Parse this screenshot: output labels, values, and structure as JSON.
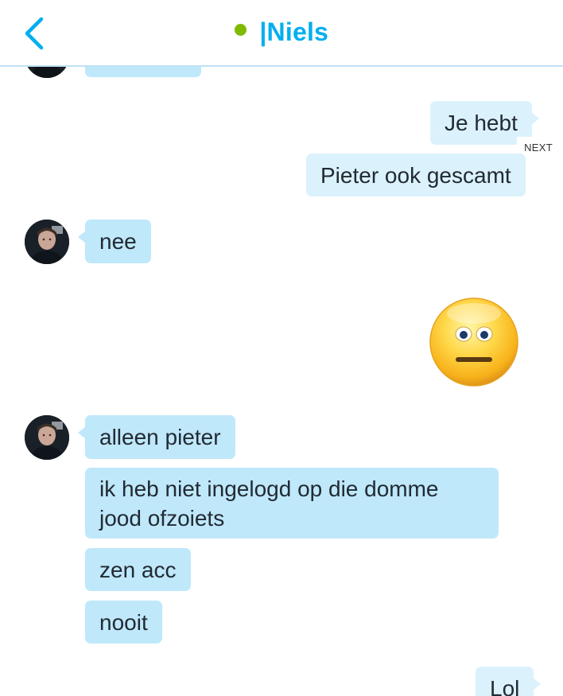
{
  "header": {
    "back_icon": "chevron-left-icon",
    "presence_color": "#7fba00",
    "contact_name": "|Niels"
  },
  "hint": {
    "next_label": "NEXT"
  },
  "messages": [
    {
      "from": "contact",
      "text": ""
    },
    {
      "from": "me",
      "text": "Je hebt"
    },
    {
      "from": "me",
      "text": "Pieter ook gescamt"
    },
    {
      "from": "contact",
      "text": "nee"
    },
    {
      "from": "me",
      "emoticon": "speechless-emoticon"
    },
    {
      "from": "contact",
      "text": "alleen pieter"
    },
    {
      "from": "contact",
      "text": "ik heb niet ingelogd op die domme jood ofzoiets"
    },
    {
      "from": "contact",
      "text": "zen acc"
    },
    {
      "from": "contact",
      "text": "nooit"
    },
    {
      "from": "me",
      "text": "Lol"
    }
  ],
  "colors": {
    "accent": "#00aff0",
    "incoming_bubble": "#bfe8fb",
    "outgoing_bubble": "#dbf2fd"
  }
}
